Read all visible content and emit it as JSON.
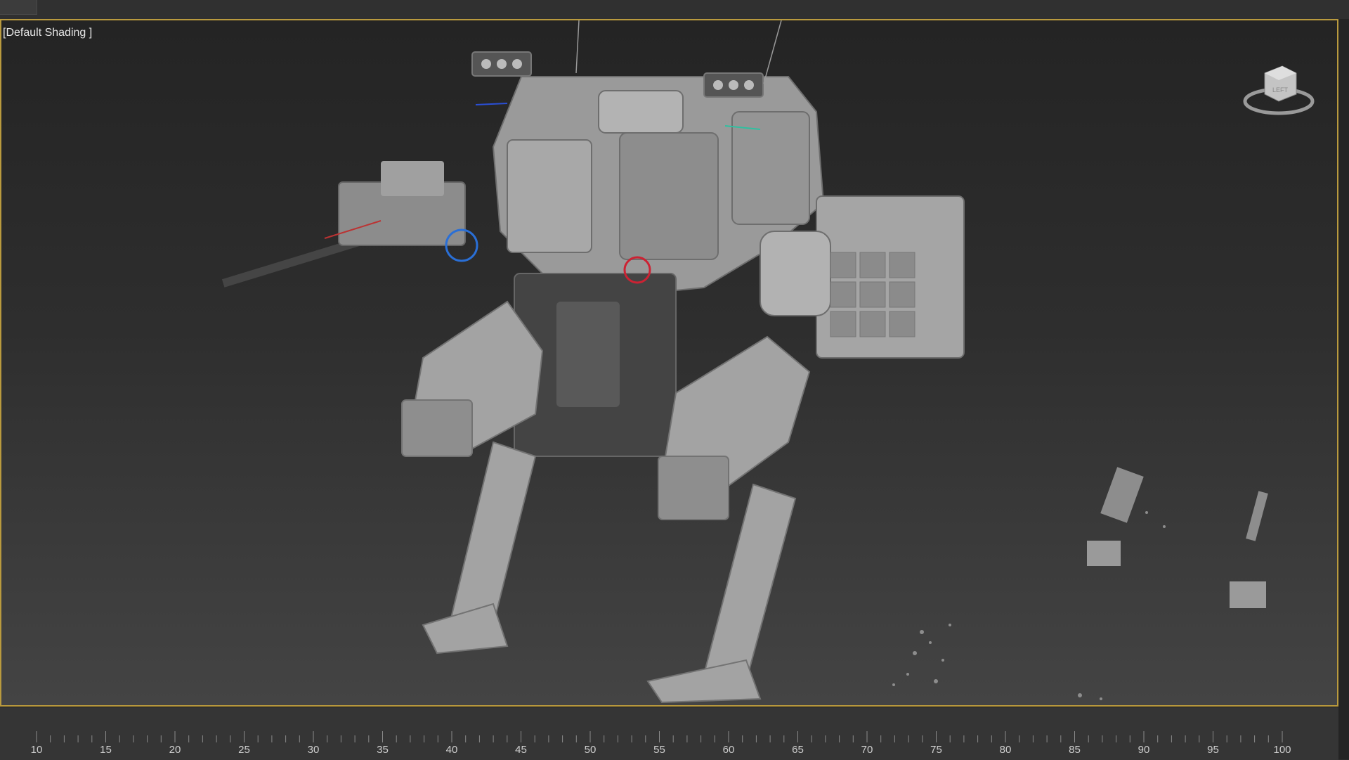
{
  "viewport": {
    "label": "[Default Shading ]"
  },
  "viewcube": {
    "icon": "viewcube-icon",
    "face_label": "LEFT"
  },
  "timeline": {
    "ticks": [
      "10",
      "15",
      "20",
      "25",
      "30",
      "35",
      "40",
      "45",
      "50",
      "55",
      "60",
      "65",
      "70",
      "75",
      "80",
      "85",
      "90",
      "95",
      "100"
    ]
  },
  "colors": {
    "viewport_border": "#b99a3e",
    "background_top": "#242424",
    "background_bottom": "#444444"
  }
}
